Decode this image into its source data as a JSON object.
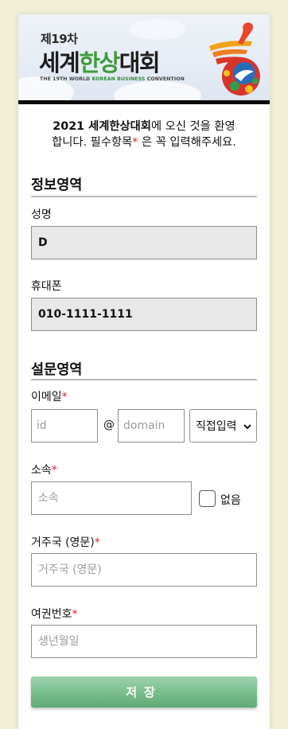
{
  "banner": {
    "edition": "제19차",
    "title_part1": "세계",
    "title_part2": "한상",
    "title_part3": "대회",
    "subtitle_part1": "THE 19TH WORLD ",
    "subtitle_part2": "KOREAN BUSINESS",
    "subtitle_part3": " CONVENTION"
  },
  "welcome": {
    "line1_bold": "2021 세계한상대회",
    "line1_rest": "에 오신 것을 환영",
    "line2_pre": "합니다. 필수항목",
    "required_mark": "*",
    "line2_post": " 은 꼭 입력해주세요."
  },
  "sections": {
    "info_title": "정보영역",
    "survey_title": "설문영역"
  },
  "fields": {
    "name": {
      "label": "성명",
      "value": "D"
    },
    "phone": {
      "label": "휴대폰",
      "value": "010-1111-1111"
    },
    "email": {
      "label": "이메일",
      "required_mark": "*",
      "id_placeholder": "id",
      "at": "@",
      "domain_placeholder": "domain",
      "domain_select": "직접입력"
    },
    "affiliation": {
      "label": "소속",
      "required_mark": "*",
      "placeholder": "소속",
      "none_label": "없음"
    },
    "country": {
      "label": "거주국 (영문)",
      "required_mark": "*",
      "placeholder": "거주국 (영문)"
    },
    "passport": {
      "label": "여권번호",
      "required_mark": "*",
      "placeholder": "생년월일"
    }
  },
  "submit_label": "저장",
  "colors": {
    "page_bg": "#f1efd6",
    "required": "#e0202a",
    "submit_green": "#79bd8b",
    "readonly_bg": "#e8e8e8",
    "banner_green": "#3d9b3a"
  }
}
